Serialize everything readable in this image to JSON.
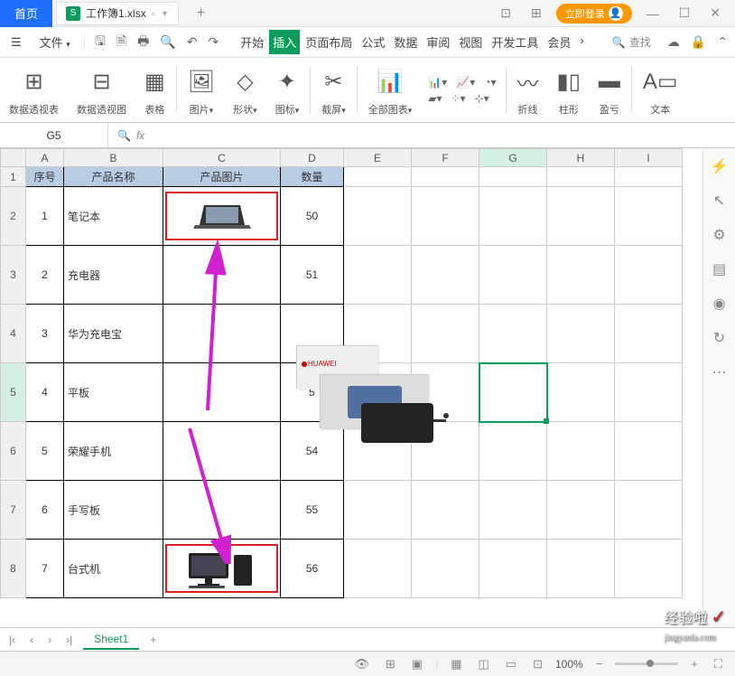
{
  "titlebar": {
    "home_tab": "首页",
    "file_tab": "工作簿1.xlsx",
    "plus": "+",
    "login": "立即登录"
  },
  "toolbar": {
    "file_menu": "文件",
    "tabs": [
      "开始",
      "插入",
      "页面布局",
      "公式",
      "数据",
      "审阅",
      "视图",
      "开发工具",
      "会员"
    ],
    "search": "查找"
  },
  "ribbon": {
    "items": [
      "数据透视表",
      "数据透视图",
      "表格",
      "图片",
      "形状",
      "图标",
      "截屏",
      "全部图表",
      "折线",
      "柱形",
      "盈亏",
      "文本"
    ]
  },
  "formula": {
    "cell": "G5",
    "fx": "fx"
  },
  "columns": [
    "A",
    "B",
    "C",
    "D",
    "E",
    "F",
    "G",
    "H",
    "I"
  ],
  "headers": [
    "序号",
    "产品名称",
    "产品图片",
    "数量"
  ],
  "rows": [
    {
      "n": "1",
      "name": "笔记本",
      "qty": "50"
    },
    {
      "n": "2",
      "name": "充电器",
      "qty": "51"
    },
    {
      "n": "3",
      "name": "华为充电宝",
      "qty": ""
    },
    {
      "n": "4",
      "name": "平板",
      "qty": "5"
    },
    {
      "n": "5",
      "name": "荣耀手机",
      "qty": "54"
    },
    {
      "n": "6",
      "name": "手写板",
      "qty": "55"
    },
    {
      "n": "7",
      "name": "台式机",
      "qty": "56"
    }
  ],
  "sheet": {
    "name": "Sheet1",
    "plus": "+"
  },
  "status": {
    "zoom": "100%"
  },
  "watermark": {
    "main": "经验啦",
    "sub": "jingyanla.com"
  }
}
